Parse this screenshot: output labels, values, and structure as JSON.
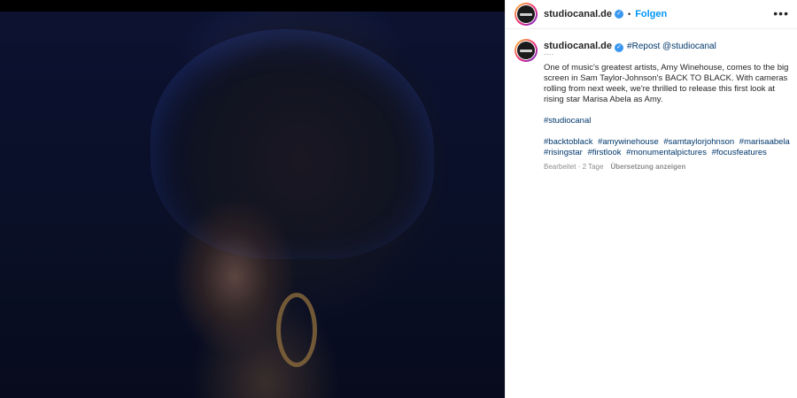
{
  "post": {
    "username": "studiocanal.de",
    "follow_label": "Folgen",
    "separator": "•",
    "more_label": "•••"
  },
  "comment": {
    "username": "studiocanal.de",
    "repost": "#Repost @studiocanal",
    "sparkles": "˙˙˙˙",
    "caption": "One of music's greatest artists, Amy Winehouse, comes to the big screen in Sam Taylor-Johnson's BACK TO BLACK. With cameras rolling from next week, we're thrilled to release this first look at rising star Marisa Abela as Amy.",
    "tag": "#studiocanal",
    "hashtags": [
      "#backtoblack",
      "#amywinehouse",
      "#samtaylorjohnson",
      "#marisaabela",
      "#risingstar",
      "#firstlook",
      "#monumentalpictures",
      "#focusfeatures"
    ],
    "edited": "Bearbeitet · 2 Tage",
    "translate": "Übersetzung anzeigen"
  },
  "colors": {
    "link": "#00376b",
    "follow": "#0095f6",
    "verified": "#3897f0"
  }
}
